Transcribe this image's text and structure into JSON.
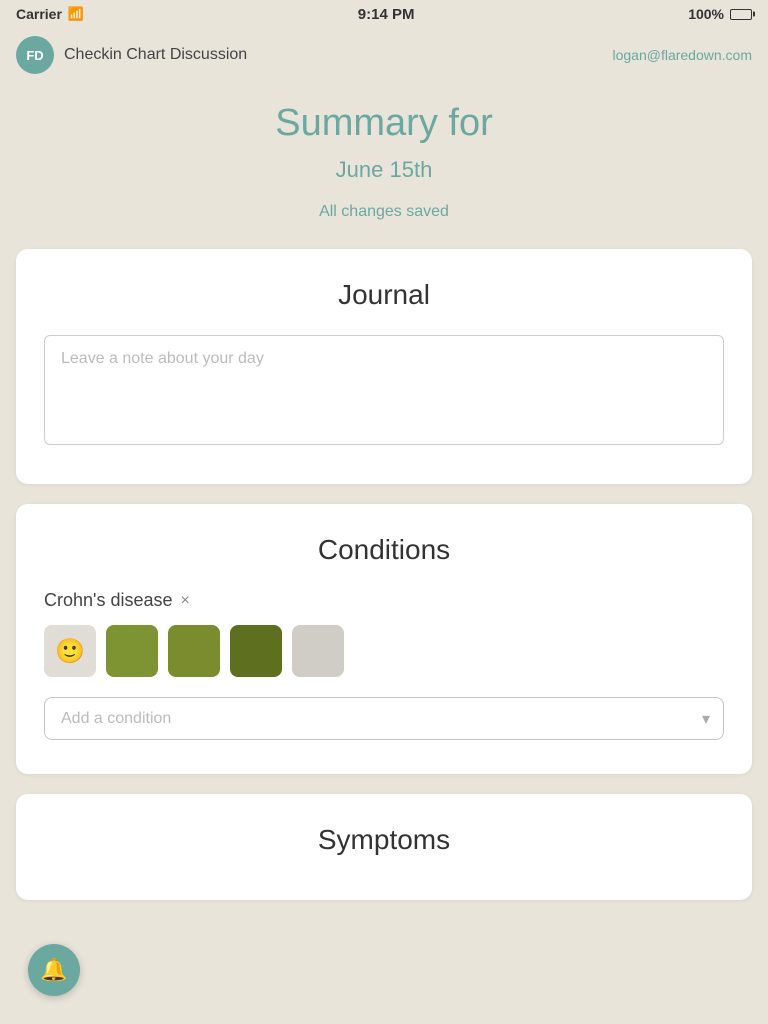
{
  "statusBar": {
    "carrier": "Carrier",
    "time": "9:14 PM",
    "battery": "100%"
  },
  "navBar": {
    "logoText": "FD",
    "title": "Checkin Chart Discussion",
    "email": "logan@flaredown.com"
  },
  "page": {
    "summaryTitle": "Summary for",
    "date": "June 15th",
    "savedStatus": "All changes saved"
  },
  "journal": {
    "title": "Journal",
    "placeholder": "Leave a note about your day",
    "value": ""
  },
  "conditions": {
    "title": "Conditions",
    "items": [
      {
        "name": "Crohn's disease",
        "severityLevels": [
          "😊",
          "",
          "",
          "",
          ""
        ]
      }
    ],
    "addPlaceholder": "Add a condition"
  },
  "symptoms": {
    "title": "Symptoms"
  },
  "fab": {
    "icon": "🔔"
  }
}
